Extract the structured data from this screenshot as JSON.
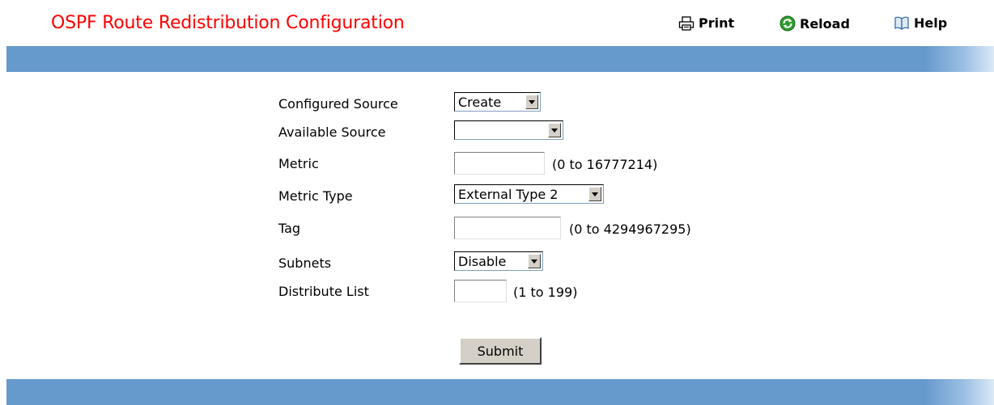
{
  "header": {
    "title": "OSPF Route Redistribution Configuration",
    "print_label": "Print",
    "reload_label": "Reload",
    "help_label": "Help"
  },
  "form": {
    "configured_source": {
      "label": "Configured Source",
      "value": "Create"
    },
    "available_source": {
      "label": "Available Source",
      "value": ""
    },
    "metric": {
      "label": "Metric",
      "value": "",
      "range": "(0 to 16777214)"
    },
    "metric_type": {
      "label": "Metric Type",
      "value": "External Type 2"
    },
    "tag": {
      "label": "Tag",
      "value": "",
      "range": "(0 to 4294967295)"
    },
    "subnets": {
      "label": "Subnets",
      "value": "Disable"
    },
    "distribute_list": {
      "label": "Distribute List",
      "value": "",
      "range": "(1 to 199)"
    }
  },
  "submit_label": "Submit",
  "colors": {
    "title": "#ff0000",
    "bar": "#6699cc"
  }
}
